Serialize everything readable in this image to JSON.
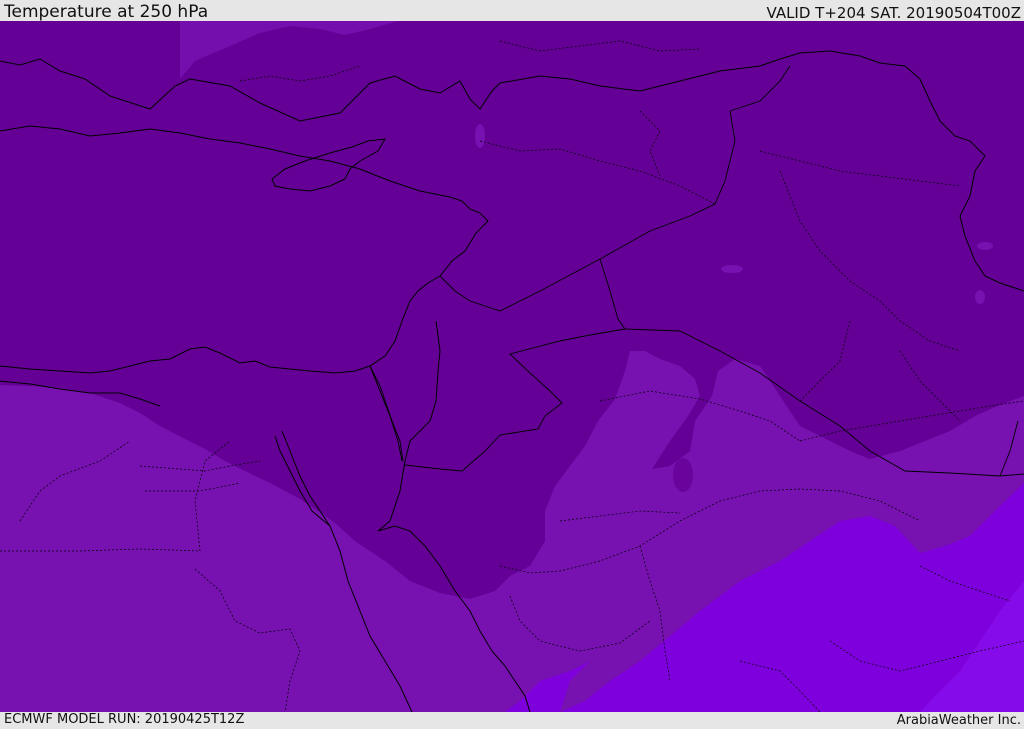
{
  "header": {
    "title": "Temperature at 250 hPa",
    "valid": "VALID T+204 SAT. 20190504T00Z"
  },
  "footer": {
    "model_run": "ECMWF MODEL RUN: 20190425T12Z",
    "credit": "ArabiaWeather Inc."
  },
  "map": {
    "field_colors": {
      "coldest": "#650096",
      "cold": "#7711b0",
      "mild": "#7e00dc",
      "warm": "#8a10f0"
    },
    "coastline_color": "#000000"
  }
}
